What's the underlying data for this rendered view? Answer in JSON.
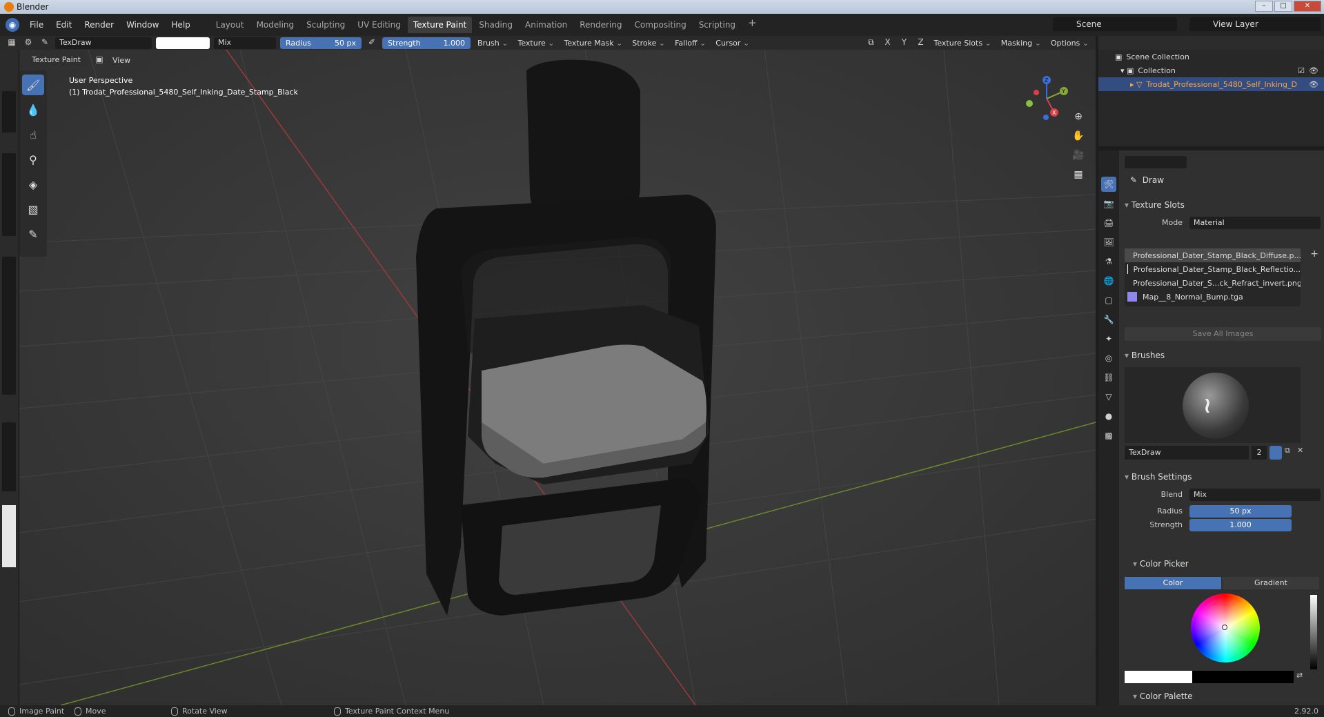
{
  "window": {
    "title": "Blender"
  },
  "menu": {
    "items": [
      "File",
      "Edit",
      "Render",
      "Window",
      "Help"
    ],
    "workspace_tabs": [
      "Layout",
      "Modeling",
      "Sculpting",
      "UV Editing",
      "Texture Paint",
      "Shading",
      "Animation",
      "Rendering",
      "Compositing",
      "Scripting"
    ],
    "active_tab": "Texture Paint",
    "scene": "Scene",
    "view_layer": "View Layer"
  },
  "tool_header": {
    "brush_name": "TexDraw",
    "blend": "Mix",
    "radius_label": "Radius",
    "radius_value": "50 px",
    "strength_label": "Strength",
    "strength_value": "1.000",
    "menus": [
      "Brush",
      "Texture",
      "Texture Mask",
      "Stroke",
      "Falloff",
      "Cursor"
    ],
    "right_menus": [
      "Texture Slots",
      "Masking",
      "Options"
    ],
    "axes": [
      "X",
      "Y",
      "Z"
    ]
  },
  "mode_header": {
    "mode": "Texture Paint",
    "view": "View"
  },
  "viewport": {
    "line1": "User Perspective",
    "line2": "(1) Trodat_Professional_5480_Self_Inking_Date_Stamp_Black",
    "gizmo": {
      "x": "X",
      "y": "Y",
      "z": "Z"
    }
  },
  "outliner": {
    "scene_collection": "Scene Collection",
    "collection": "Collection",
    "object": "Trodat_Professional_5480_Self_Inking_D"
  },
  "properties": {
    "tool_name": "Draw",
    "texture_slots": {
      "title": "Texture Slots",
      "mode_label": "Mode",
      "mode_value": "Material",
      "slots": [
        {
          "name": "Professional_Dater_Stamp_Black_Diffuse.p...",
          "color": "#ffffff"
        },
        {
          "name": "Professional_Dater_Stamp_Black_Reflectio...",
          "color": "#ffffff"
        },
        {
          "name": "Professional_Dater_S...ck_Refract_invert.png",
          "color": "#ffffff"
        },
        {
          "name": "Map__8_Normal_Bump.tga",
          "color": "#8f86f0"
        }
      ],
      "save_all": "Save All Images"
    },
    "brushes": {
      "title": "Brushes",
      "brush_name": "TexDraw",
      "users": "2"
    },
    "brush_settings": {
      "title": "Brush Settings",
      "blend_label": "Blend",
      "blend_value": "Mix",
      "radius_label": "Radius",
      "radius_value": "50 px",
      "strength_label": "Strength",
      "strength_value": "1.000"
    },
    "color_picker": {
      "title": "Color Picker",
      "tab_color": "Color",
      "tab_gradient": "Gradient"
    },
    "color_palette": {
      "title": "Color Palette"
    }
  },
  "statusbar": {
    "image_paint": "Image Paint",
    "move": "Move",
    "rotate": "Rotate View",
    "context": "Texture Paint Context Menu",
    "version": "2.92.0"
  },
  "colors": {
    "accent": "#4772b3",
    "background": "#3a3a3a",
    "selected_object": "#f6a84a"
  }
}
